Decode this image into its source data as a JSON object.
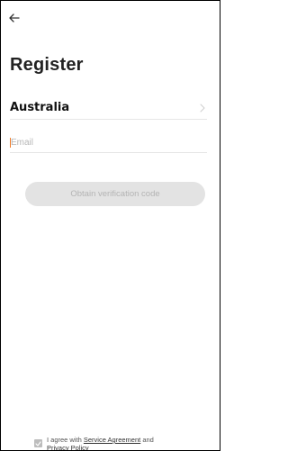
{
  "header": {
    "back_icon": "arrow-left-icon",
    "title": "Register"
  },
  "country": {
    "name": "Australia",
    "chevron_icon": "chevron-right-icon"
  },
  "email": {
    "placeholder": "Email",
    "value": ""
  },
  "verify_button": {
    "label": "Obtain verification code",
    "enabled": false
  },
  "agreement": {
    "checked": true,
    "prefix": "I agree with ",
    "service_link": "Service Agreement",
    "middle": " and",
    "privacy_link": "Privacy Policy"
  },
  "colors": {
    "cursor": "#f07c2a",
    "button_bg": "#e3e3e3",
    "button_text": "#b4b4b4",
    "divider": "#e6e6e6"
  }
}
